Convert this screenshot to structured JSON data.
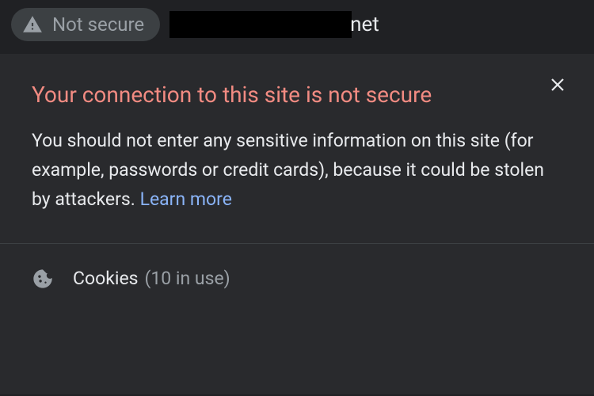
{
  "address": {
    "chip_label": "Not secure",
    "url_suffix": "net"
  },
  "popup": {
    "title": "Your connection to this site is not secure",
    "body": "You should not enter any sensitive information on this site (for example, passwords or credit cards), because it could be stolen by attackers. ",
    "learn_more": "Learn more"
  },
  "cookies": {
    "label": "Cookies",
    "count_text": "(10 in use)"
  },
  "icons": {
    "warning": "warning-triangle",
    "close": "close-x",
    "cookie": "cookie"
  },
  "colors": {
    "warn_title": "#f28b82",
    "link": "#8ab4f8",
    "bg": "#202124",
    "popup_bg": "#292a2d"
  }
}
